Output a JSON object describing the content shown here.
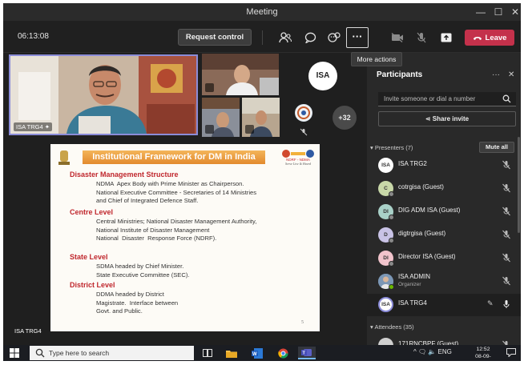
{
  "window": {
    "title": "Meeting",
    "controls": [
      "—",
      "☐",
      "✕"
    ]
  },
  "toolbar": {
    "timer": "06:13:08",
    "request_control_label": "Request control",
    "more_label": "···",
    "leave_label": "Leave",
    "tooltip": "More actions",
    "icons": [
      "participants-icon",
      "chat-icon",
      "reactions-icon",
      "more-actions-icon",
      "camera-off-icon",
      "mic-off-icon",
      "share-tray-icon",
      "phone-icon"
    ],
    "leave_color": "#c4314b"
  },
  "video": {
    "main_tile_label": "ISA TRG4",
    "avatar_initials": "ISA",
    "overflow_count": "+32",
    "presenter_label": "ISA TRG4"
  },
  "slide": {
    "title": "Institutional Framework for DM in India",
    "logo_caption": "NDRF ◦ NDMA",
    "logo_tagline": "Serve Live & Heard",
    "sections": [
      {
        "heading": "Disaster Management Structure",
        "body": "NDMA  Apex Body with Prime Minister as Chairperson.\nNational Executive Committee - Secretaries of 14 Ministries\nand Chief of Integrated Defence Staff."
      },
      {
        "heading": "Centre Level",
        "body": "Central Ministries; National Disaster Management Authority,\nNational Institute of Disaster Management\nNational  Disaster  Response Force (NDRF)."
      },
      {
        "heading": "State Level",
        "body": "SDMA headed by Chief Minister.\nState Executive Committee (SEC)."
      },
      {
        "heading": "District Level",
        "body": "DDMA headed by District\nMagistrate.  Interface between\nGovt. and Public."
      }
    ],
    "page_number": "5",
    "heading_color": "#c0272d"
  },
  "panel": {
    "title": "Participants",
    "invite_placeholder": "Invite someone or dial a number",
    "share_invite_label": "Share invite",
    "presenters_header": "Presenters (7)",
    "mute_all_label": "Mute all",
    "attendees_header": "Attendees (35)",
    "participants": [
      {
        "initials": "ISA",
        "name": "ISA TRG2",
        "sub": "",
        "avatar_color": "#ffffff"
      },
      {
        "initials": "C",
        "name": "cotrgisa (Guest)",
        "sub": "",
        "avatar_color": "#c8d8a8"
      },
      {
        "initials": "DI",
        "name": "DIG ADM ISA (Guest)",
        "sub": "",
        "avatar_color": "#a9d1c8"
      },
      {
        "initials": "D",
        "name": "digtrgisa (Guest)",
        "sub": "",
        "avatar_color": "#c9c3e6"
      },
      {
        "initials": "DI",
        "name": "Director ISA (Guest)",
        "sub": "",
        "avatar_color": "#f2c4cc"
      },
      {
        "initials": "",
        "name": "ISA ADMIN",
        "sub": "Organizer",
        "avatar_color": "#6a8fb5"
      },
      {
        "initials": "ISA",
        "name": "ISA TRG4",
        "sub": "",
        "avatar_color": "#ffffff"
      },
      {
        "initials": "",
        "name": "171RNCBPF (Guest)",
        "sub": "",
        "avatar_color": "#cfcfcf"
      }
    ]
  },
  "taskbar": {
    "search_placeholder": "Type here to search",
    "tray_text": "^ 🗨 🔈 ENG",
    "time": "12:52",
    "date": "08-09-2021"
  }
}
